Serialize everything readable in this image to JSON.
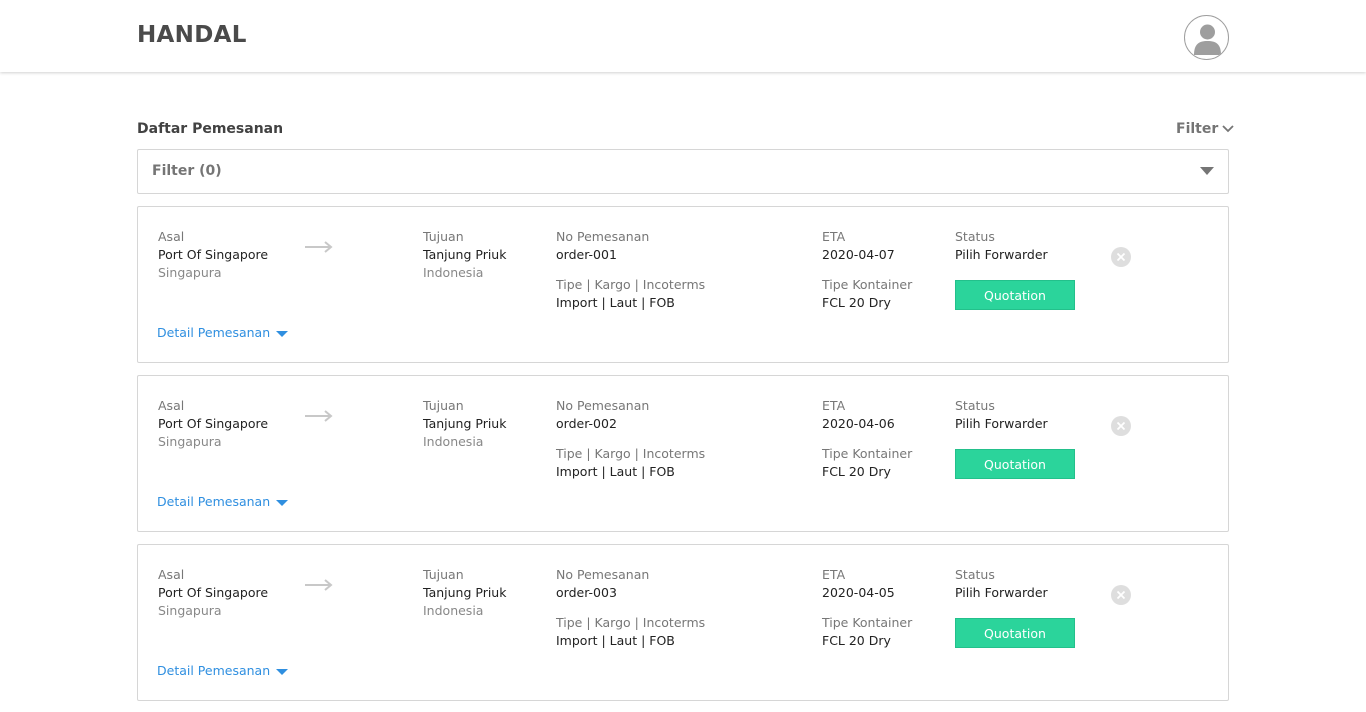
{
  "header": {
    "brand": "HANDAL",
    "avatar_icon": "user-avatar-icon"
  },
  "section": {
    "title": "Daftar Pemesanan",
    "filter_toggle": "Filter"
  },
  "filter_select": {
    "value": "Filter (0)"
  },
  "labels": {
    "origin": "Asal",
    "destination": "Tujuan",
    "order_no": "No Pemesanan",
    "type_cargo_incoterms": "Tipe | Kargo | Incoterms",
    "eta": "ETA",
    "container_type": "Tipe Kontainer",
    "status": "Status",
    "detail": "Detail Pemesanan"
  },
  "colors": {
    "accent_green": "#2bd49b",
    "link_blue": "#2f8fe0"
  },
  "orders": [
    {
      "origin_port": "Port Of Singapore",
      "origin_country": "Singapura",
      "dest_port": "Tanjung Priuk",
      "dest_country": "Indonesia",
      "order_no": "order-001",
      "type_cargo_incoterms": "Import | Laut | FOB",
      "eta": "2020-04-07",
      "container_type": "FCL 20 Dry",
      "status": "Pilih Forwarder",
      "action": "Quotation"
    },
    {
      "origin_port": "Port Of Singapore",
      "origin_country": "Singapura",
      "dest_port": "Tanjung Priuk",
      "dest_country": "Indonesia",
      "order_no": "order-002",
      "type_cargo_incoterms": "Import | Laut | FOB",
      "eta": "2020-04-06",
      "container_type": "FCL 20 Dry",
      "status": "Pilih Forwarder",
      "action": "Quotation"
    },
    {
      "origin_port": "Port Of Singapore",
      "origin_country": "Singapura",
      "dest_port": "Tanjung Priuk",
      "dest_country": "Indonesia",
      "order_no": "order-003",
      "type_cargo_incoterms": "Import | Laut | FOB",
      "eta": "2020-04-05",
      "container_type": "FCL 20 Dry",
      "status": "Pilih Forwarder",
      "action": "Quotation"
    }
  ]
}
